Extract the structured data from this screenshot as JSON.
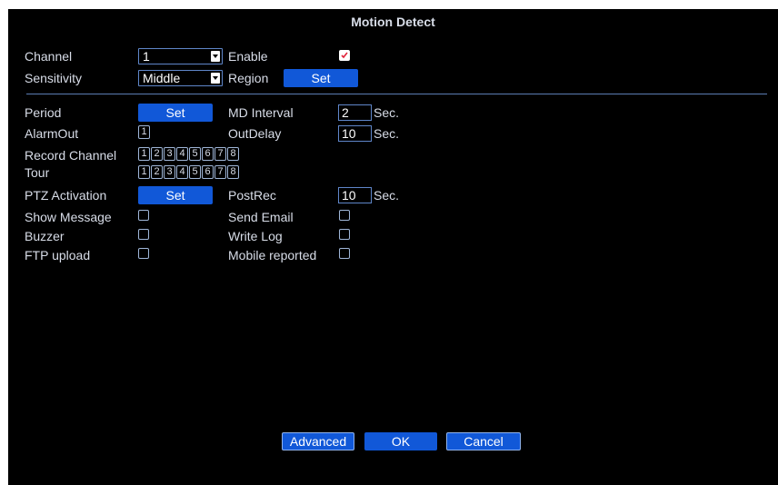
{
  "dialog": {
    "title": "Motion Detect"
  },
  "fields": {
    "channel": {
      "label": "Channel",
      "value": "1"
    },
    "enable": {
      "label": "Enable",
      "checked": true
    },
    "sensitivity": {
      "label": "Sensitivity",
      "value": "Middle"
    },
    "region": {
      "label": "Region",
      "button": "Set"
    },
    "period": {
      "label": "Period",
      "button": "Set"
    },
    "md_interval": {
      "label": "MD Interval",
      "value": "2",
      "unit": "Sec."
    },
    "alarm_out": {
      "label": "AlarmOut",
      "channels": [
        "1"
      ]
    },
    "out_delay": {
      "label": "OutDelay",
      "value": "10",
      "unit": "Sec."
    },
    "record_channel": {
      "label": "Record Channel",
      "channels": [
        "1",
        "2",
        "3",
        "4",
        "5",
        "6",
        "7",
        "8"
      ]
    },
    "tour": {
      "label": "Tour",
      "channels": [
        "1",
        "2",
        "3",
        "4",
        "5",
        "6",
        "7",
        "8"
      ]
    },
    "ptz_activation": {
      "label": "PTZ Activation",
      "button": "Set"
    },
    "post_rec": {
      "label": "PostRec",
      "value": "10",
      "unit": "Sec."
    },
    "show_message": {
      "label": "Show Message",
      "checked": false
    },
    "send_email": {
      "label": "Send Email",
      "checked": false
    },
    "buzzer": {
      "label": "Buzzer",
      "checked": false
    },
    "write_log": {
      "label": "Write Log",
      "checked": false
    },
    "ftp_upload": {
      "label": "FTP upload",
      "checked": false
    },
    "mobile_reported": {
      "label": "Mobile reported",
      "checked": false
    }
  },
  "footer": {
    "advanced": "Advanced",
    "ok": "OK",
    "cancel": "Cancel"
  },
  "colors": {
    "background": "#000000",
    "button": "#1158d8",
    "text": "#d8dde8",
    "accent_check": "#e0233a"
  }
}
